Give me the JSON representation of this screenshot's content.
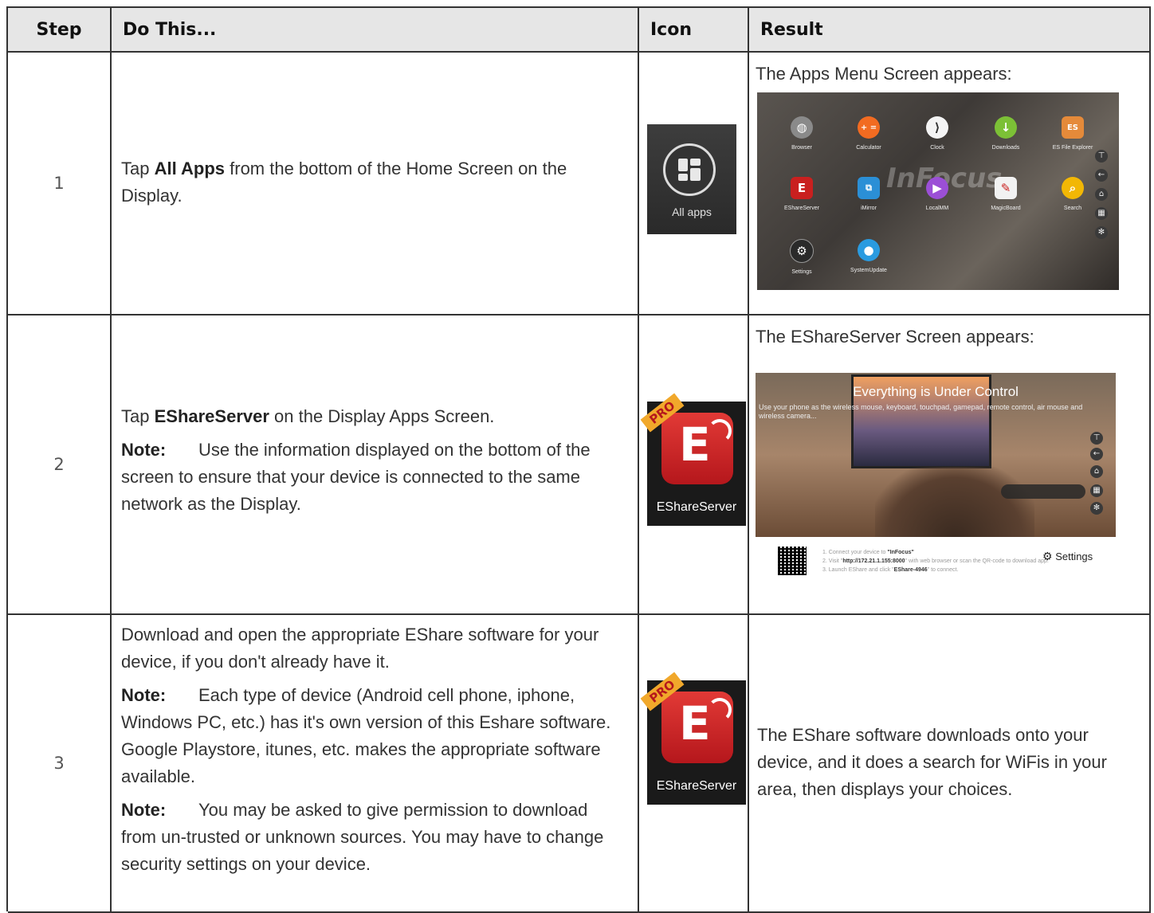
{
  "headers": {
    "step": "Step",
    "do_this": "Do This...",
    "icon": "Icon",
    "result": "Result"
  },
  "rows": [
    {
      "step": "1",
      "instruction_pre": "Tap ",
      "instruction_bold": "All Apps",
      "instruction_post": " from the bottom of the Home Screen on the Display.",
      "icon_label": "All apps",
      "result_caption": "The Apps Menu Screen appears:",
      "apps_screen": {
        "brand": "InFocus",
        "apps": [
          "Browser",
          "Calculator",
          "Clock",
          "Downloads",
          "ES File Explorer",
          "EShareServer",
          "iMirror",
          "LocalMM",
          "MagicBoard",
          "Search",
          "Settings",
          "SystemUpdate"
        ]
      }
    },
    {
      "step": "2",
      "instruction_pre": "Tap ",
      "instruction_bold": "EShareServer",
      "instruction_post": " on the Display Apps Screen.",
      "note_label": "Note:",
      "note_text": "Use the information displayed on the bottom of the screen to  ensure that your device is connected to the same network as the Display.",
      "icon_label": "EShareServer",
      "icon_badge": "PRO",
      "result_caption": "The EShareServer Screen appears:",
      "eshare_screen": {
        "title": "Everything is Under Control",
        "subtitle": "Use your phone as the wireless mouse, keyboard, touchpad, gamepad, remote control, air mouse and wireless camera...",
        "step1_pre": "1. Connect your device to ",
        "step1_value": "\"InFocus\"",
        "step2_pre": "2. Visit \"",
        "step2_value": "http://172.21.1.155:8000",
        "step2_post": "\" with web browser or scan the QR-code to download app.",
        "step3_pre": "3. Launch EShare and click \"",
        "step3_value": "EShare-4946",
        "step3_post": "\" to connect.",
        "settings_label": "Settings"
      }
    },
    {
      "step": "3",
      "instruction": "Download and open the appropriate EShare software for your device, if you don't already have it.",
      "note1_label": "Note:",
      "note1_text": "Each type of device (Android cell phone, iphone, Windows PC, etc.) has it's own version of this Eshare software. Google Playstore, itunes, etc. makes the appropriate software available.",
      "note2_label": "Note:",
      "note2_text": "You may be asked to give permission to download from un-trusted or unknown sources. You may have to change security settings on your device.",
      "icon_label": "EShareServer",
      "icon_badge": "PRO",
      "result_text": "The EShare software downloads onto your device, and it does a search for WiFis in your area, then displays your choices."
    }
  ],
  "colors": {
    "header_bg": "#e6e6e6",
    "border": "#333333",
    "eshare_red": "#c9201f"
  }
}
